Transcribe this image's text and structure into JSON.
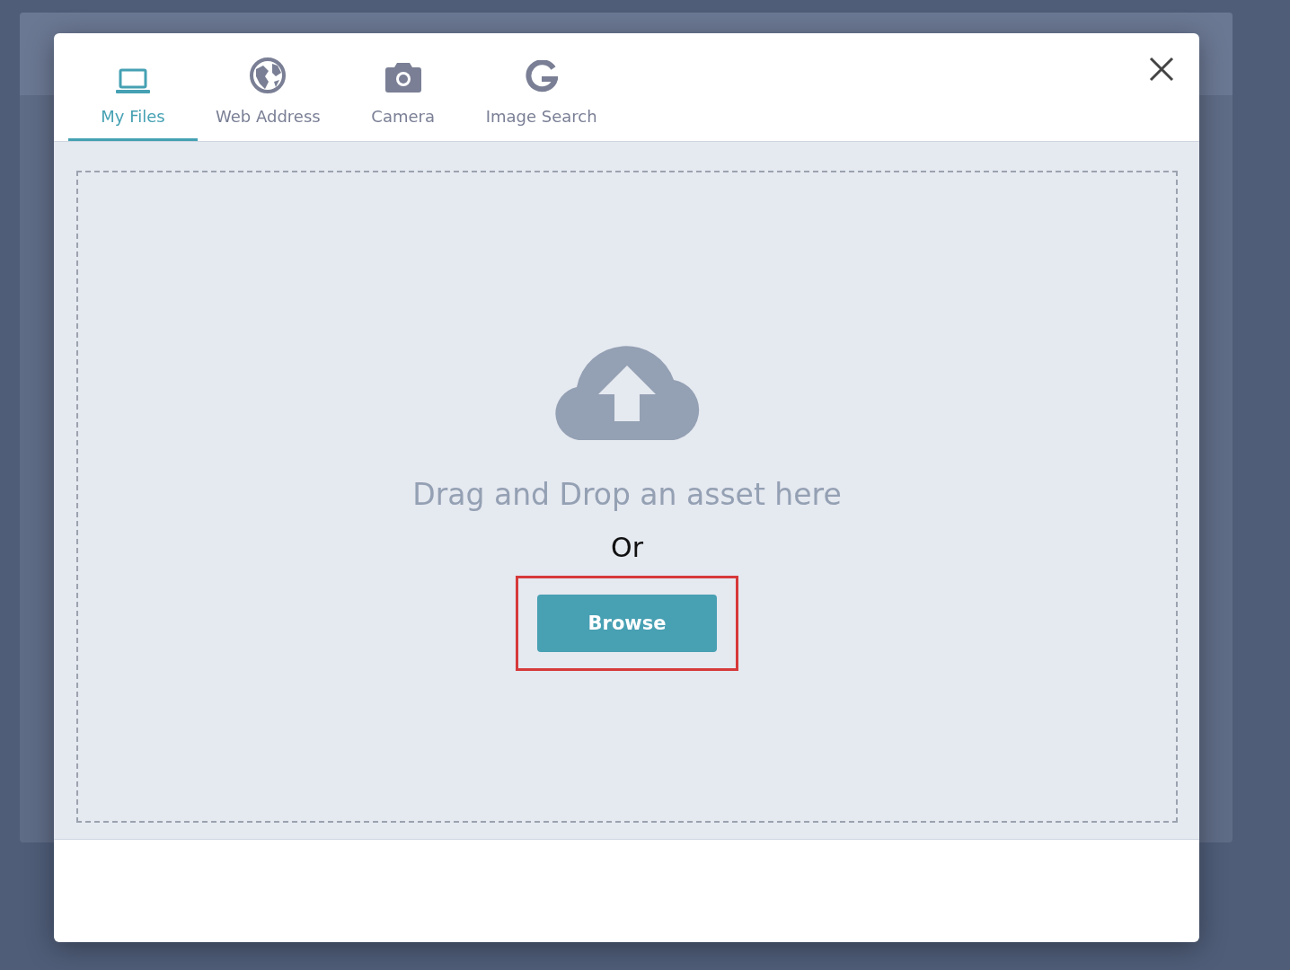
{
  "dialog": {
    "tabs": [
      {
        "label": "My Files",
        "selected": true
      },
      {
        "label": "Web Address",
        "selected": false
      },
      {
        "label": "Camera",
        "selected": false
      },
      {
        "label": "Image Search",
        "selected": false
      }
    ]
  },
  "dropzone": {
    "message": "Drag and Drop an asset here",
    "separator": "Or",
    "button": {
      "label": "Browse",
      "highlighted": true
    }
  }
}
